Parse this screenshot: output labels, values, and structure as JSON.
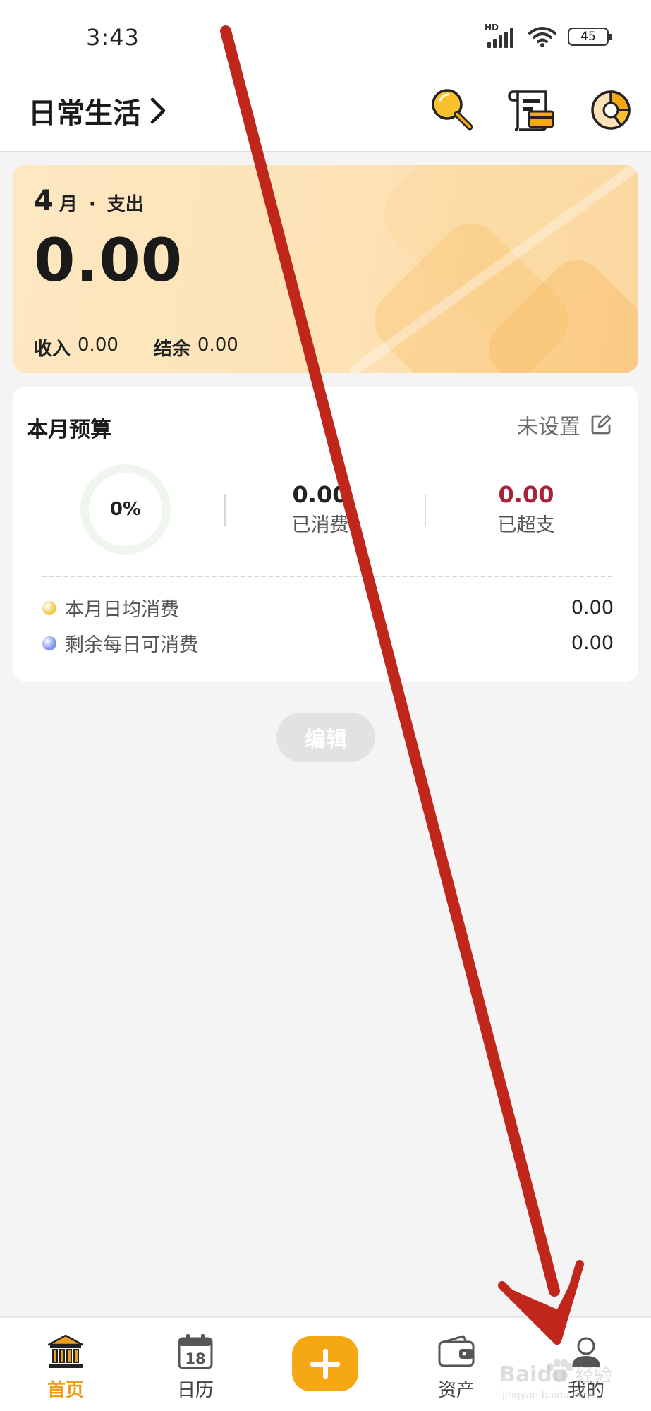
{
  "status_bar": {
    "time": "3:43",
    "network_badge": "HD",
    "battery": "45"
  },
  "header": {
    "book_title": "日常生活",
    "icons": [
      "search-icon",
      "bill-scroll-icon",
      "pie-chart-icon"
    ]
  },
  "summary": {
    "month": "4",
    "month_unit": "月",
    "separator": "·",
    "type": "支出",
    "amount": "0.00",
    "income_label": "收入",
    "income_value": "0.00",
    "balance_label": "结余",
    "balance_value": "0.00"
  },
  "budget": {
    "title": "本月预算",
    "setting_label": "未设置",
    "ring_percent": "0%",
    "ring_fill_fraction": 0,
    "spent_value": "0.00",
    "spent_label": "已消费",
    "over_value": "0.00",
    "over_label": "已超支",
    "rows": [
      {
        "label": "本月日均消费",
        "value": "0.00",
        "dot_color": "#f2c94c"
      },
      {
        "label": "剩余每日可消费",
        "value": "0.00",
        "dot_color": "#7b93f0"
      }
    ]
  },
  "edit_button_label": "编辑",
  "bottom_nav": {
    "items": [
      {
        "label": "首页",
        "icon": "bank-icon",
        "active": true
      },
      {
        "label": "日历",
        "icon": "calendar-icon",
        "active": false,
        "icon_text": "18"
      },
      {
        "label": "资产",
        "icon": "wallet-icon",
        "active": false
      },
      {
        "label": "我的",
        "icon": "user-icon",
        "active": false
      }
    ],
    "add_icon": "plus-icon"
  },
  "colors": {
    "accent": "#f6a814",
    "active_nav": "#e9a01c",
    "over_budget": "#a8233a",
    "annotation_arrow": "#c0271a"
  },
  "watermark": {
    "brand": "Baidu",
    "brand_cn": "经验",
    "url": "jingyan.baidu.com"
  }
}
